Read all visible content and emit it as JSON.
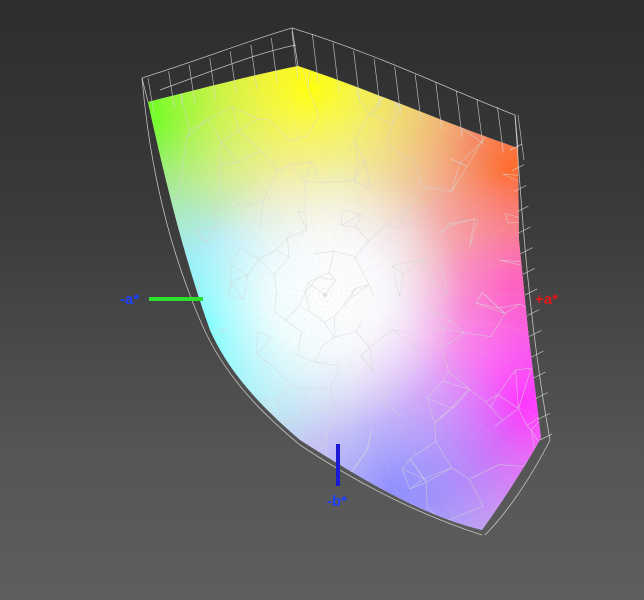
{
  "axes": {
    "neg_a": {
      "label": "-a*",
      "color": "#1f3fff"
    },
    "pos_a": {
      "label": "+a*",
      "color": "#e01818"
    },
    "neg_b": {
      "label": "-b*",
      "color": "#1f3fff"
    }
  },
  "colors": {
    "green_axis": "#2ee02e",
    "blue_axis": "#1b1bd6",
    "mesh": "#d6d6d6"
  }
}
